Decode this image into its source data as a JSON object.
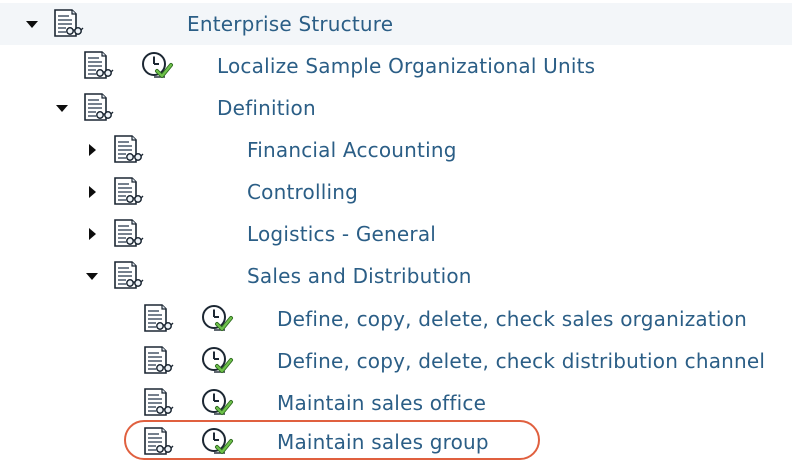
{
  "tree": {
    "nodes": [
      {
        "label": "Enterprise Structure",
        "expander": "expanded",
        "icons": [
          "document-icon"
        ]
      },
      {
        "label": "Localize Sample Organizational Units",
        "expander": "none",
        "icons": [
          "document-icon",
          "execute-clock-icon"
        ]
      },
      {
        "label": "Definition",
        "expander": "expanded",
        "icons": [
          "document-icon"
        ]
      },
      {
        "label": "Financial Accounting",
        "expander": "collapsed",
        "icons": [
          "document-icon"
        ]
      },
      {
        "label": "Controlling",
        "expander": "collapsed",
        "icons": [
          "document-icon"
        ]
      },
      {
        "label": "Logistics - General",
        "expander": "collapsed",
        "icons": [
          "document-icon"
        ]
      },
      {
        "label": "Sales and Distribution",
        "expander": "expanded",
        "icons": [
          "document-icon"
        ]
      },
      {
        "label": "Define, copy, delete, check sales organization",
        "expander": "none",
        "icons": [
          "document-icon",
          "execute-clock-icon"
        ]
      },
      {
        "label": "Define, copy, delete, check distribution channel",
        "expander": "none",
        "icons": [
          "document-icon",
          "execute-clock-icon"
        ]
      },
      {
        "label": "Maintain sales office",
        "expander": "none",
        "icons": [
          "document-icon",
          "execute-clock-icon"
        ]
      },
      {
        "label": "Maintain sales group",
        "expander": "none",
        "icons": [
          "document-icon",
          "execute-clock-icon"
        ],
        "highlighted": true
      }
    ]
  },
  "colors": {
    "label_text": "#2b5e86",
    "highlight_oval": "#e0603f",
    "row_band": "#f3f6f9"
  }
}
